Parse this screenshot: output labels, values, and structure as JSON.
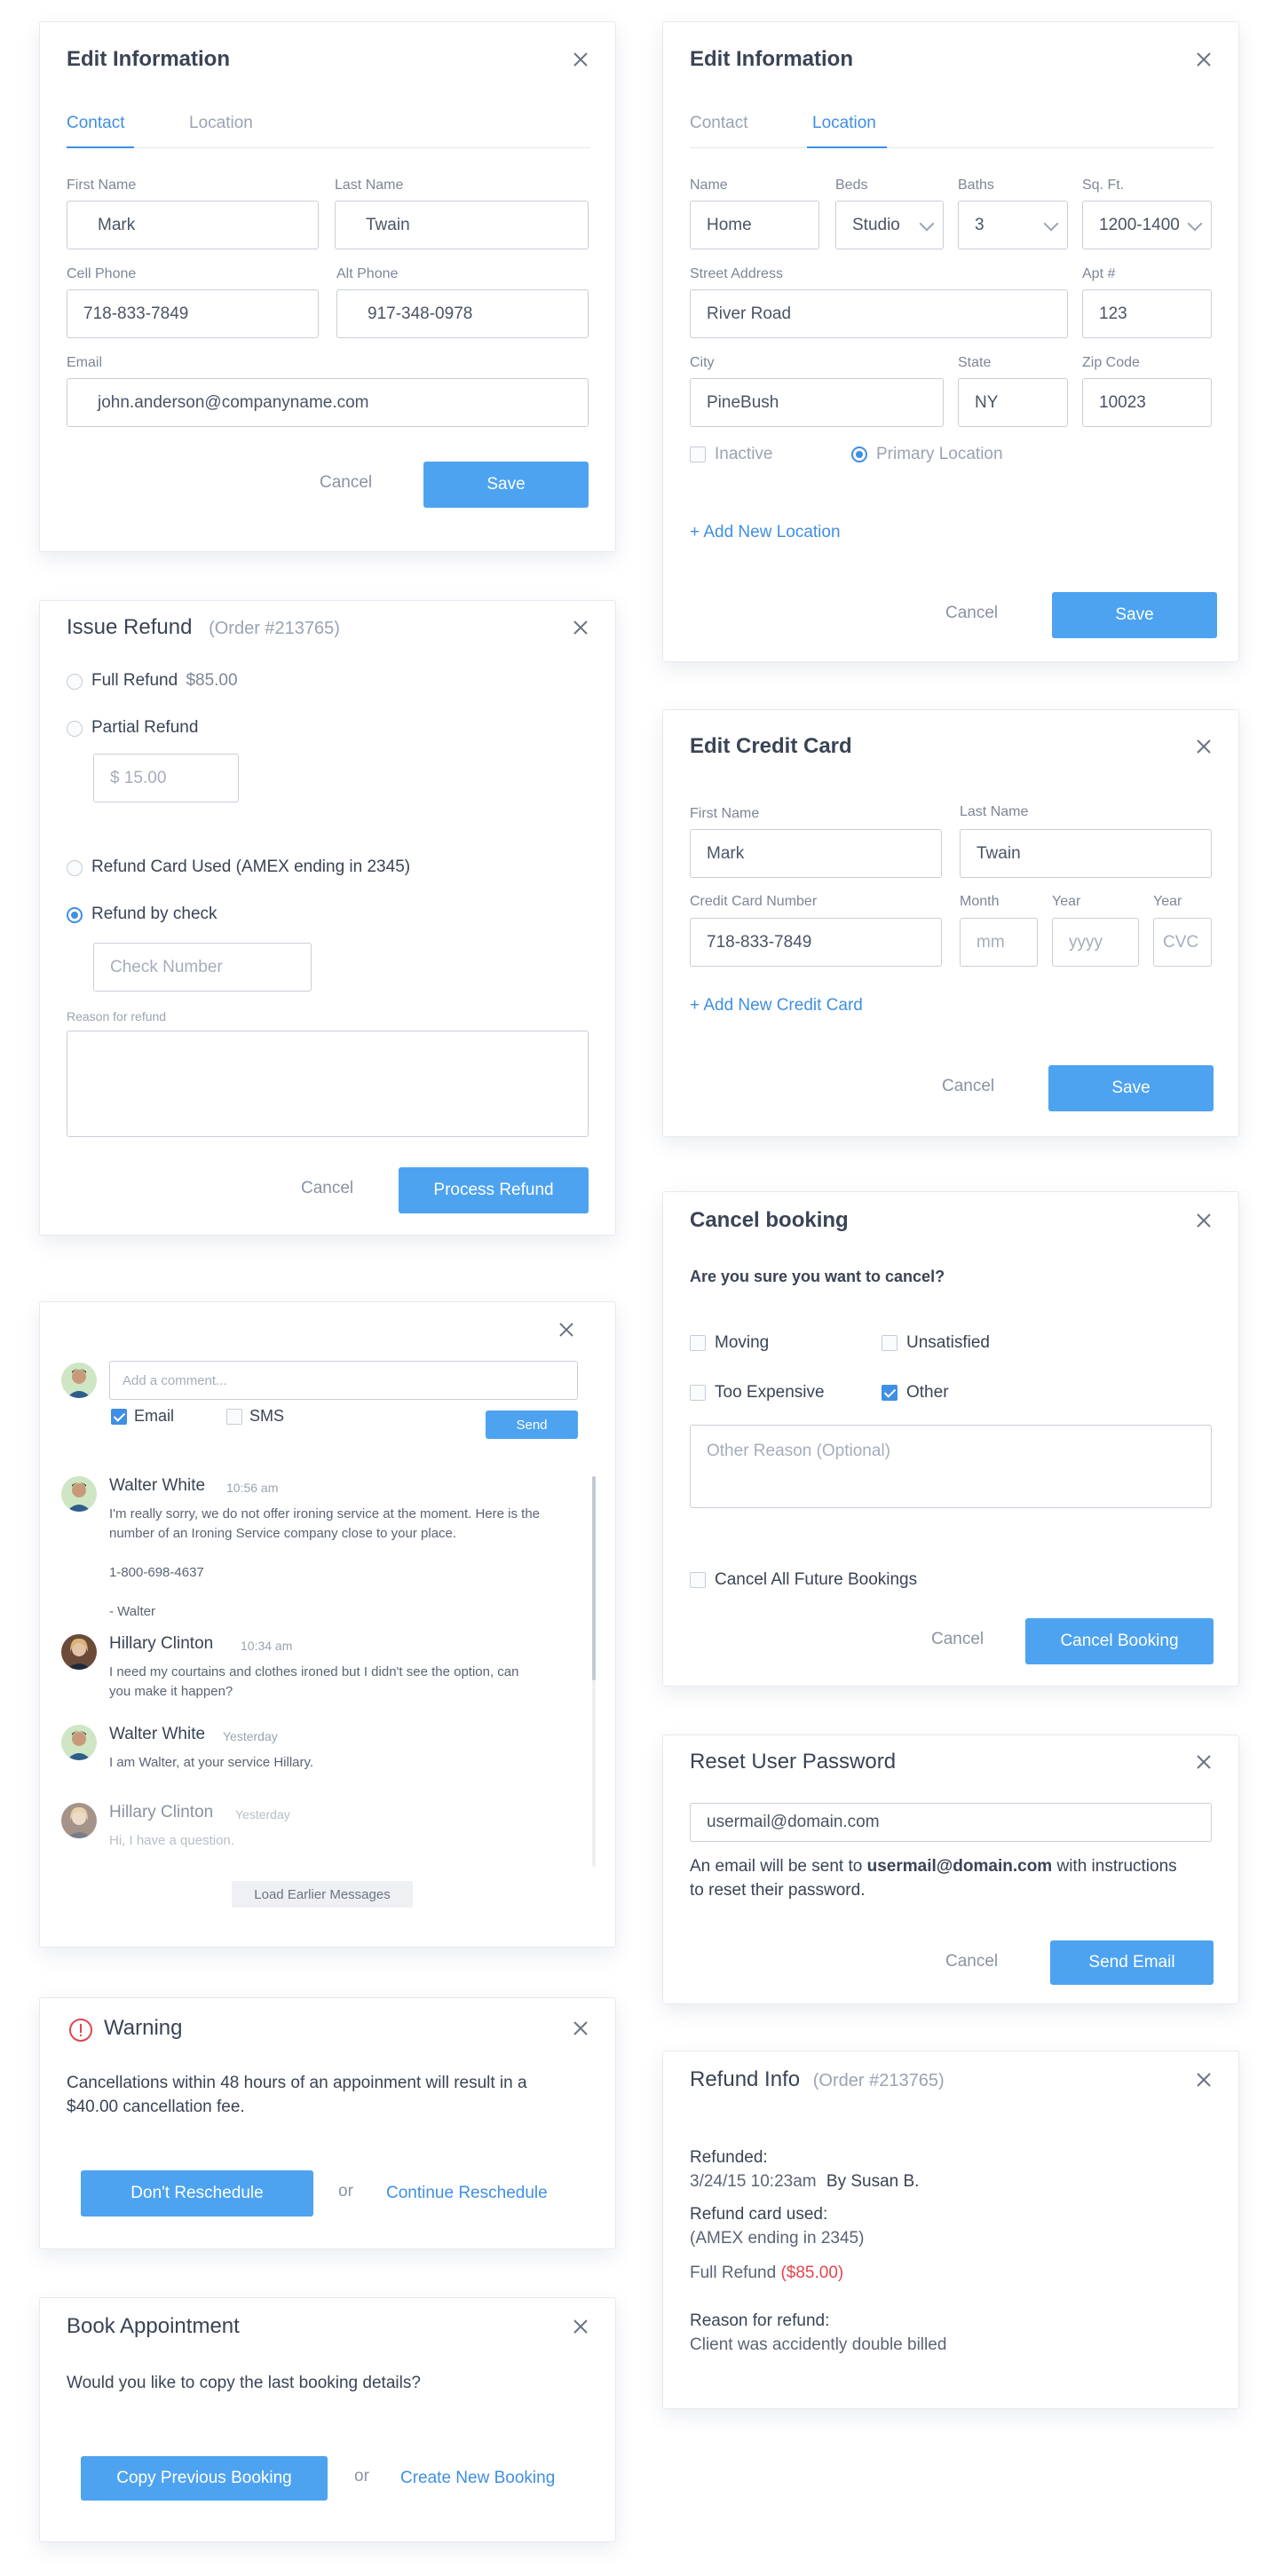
{
  "colors": {
    "accent": "#4da3f0",
    "link": "#3f8fe3",
    "error": "#e0464e",
    "text": "#3a4456",
    "muted": "#9aa3b2"
  },
  "icons": {
    "close": "close-icon",
    "warning": "warning-icon"
  },
  "edit_contact": {
    "title": "Edit Information",
    "tabs": [
      "Contact",
      "Location"
    ],
    "first_name_label": "First Name",
    "first_name": "Mark",
    "last_name_label": "Last Name",
    "last_name": "Twain",
    "cell_label": "Cell Phone",
    "cell": "718-833-7849",
    "alt_label": "Alt Phone",
    "alt": "917-348-0978",
    "email_label": "Email",
    "email": "john.anderson@companyname.com",
    "cancel": "Cancel",
    "save": "Save"
  },
  "edit_location": {
    "title": "Edit Information",
    "tabs": [
      "Contact",
      "Location"
    ],
    "name_label": "Name",
    "name": "Home",
    "beds_label": "Beds",
    "beds": "Studio",
    "baths_label": "Baths",
    "baths": "3",
    "sqft_label": "Sq. Ft.",
    "sqft": "1200-1400",
    "street_label": "Street Address",
    "street": "River Road",
    "apt_label": "Apt #",
    "apt": "123",
    "city_label": "City",
    "city": "PineBush",
    "state_label": "State",
    "state": "NY",
    "zip_label": "Zip Code",
    "zip": "10023",
    "inactive": "Inactive",
    "primary": "Primary Location",
    "add_location": "+ Add New Location",
    "cancel": "Cancel",
    "save": "Save"
  },
  "issue_refund": {
    "title": "Issue Refund",
    "order": "(Order #213765)",
    "full_refund": "Full Refund",
    "full_amount": "$85.00",
    "partial_refund": "Partial Refund",
    "partial_amount": "$ 15.00",
    "card_used": "Refund Card Used (AMEX ending in 2345)",
    "by_check": "Refund by check",
    "check_placeholder": "Check Number",
    "reason_label": "Reason for refund",
    "cancel": "Cancel",
    "process": "Process Refund"
  },
  "edit_card": {
    "title": "Edit Credit Card",
    "first_name_label": "First Name",
    "first_name": "Mark",
    "last_name_label": "Last Name",
    "last_name": "Twain",
    "number_label": "Credit Card Number",
    "number": "718-833-7849",
    "month_label": "Month",
    "month_placeholder": "mm",
    "year_label": "Year",
    "year_placeholder": "yyyy",
    "cvc_label": "Year",
    "cvc_placeholder": "CVC",
    "add_card": "+ Add New Credit Card",
    "cancel": "Cancel",
    "save": "Save"
  },
  "comments": {
    "placeholder": "Add a comment...",
    "email": "Email",
    "sms": "SMS",
    "send": "Send",
    "messages": [
      {
        "name": "Walter White",
        "time": "10:56 am",
        "body": [
          "I'm really sorry, we do not offer ironing service at the moment. Here is the",
          "number of an Ironing Service company close to your place.",
          "",
          "1-800-698-4637",
          "",
          "- Walter"
        ]
      },
      {
        "name": "Hillary Clinton",
        "time": "10:34 am",
        "body": [
          "I need my courtains and clothes ironed but I didn't see the option, can",
          "you make it happen?"
        ]
      },
      {
        "name": "Walter White",
        "time": "Yesterday",
        "body": [
          "I am Walter, at your service Hillary."
        ]
      },
      {
        "name": "Hillary Clinton",
        "time": "Yesterday",
        "body": [
          "Hi, I have a question."
        ]
      }
    ],
    "load_more": "Load Earlier Messages"
  },
  "cancel_booking": {
    "title": "Cancel booking",
    "question": "Are you sure you want to cancel?",
    "reasons": [
      "Moving",
      "Unsatisfied",
      "Too Expensive",
      "Other"
    ],
    "other_placeholder": "Other Reason (Optional)",
    "cancel_all": "Cancel All Future Bookings",
    "cancel": "Cancel",
    "confirm": "Cancel Booking"
  },
  "reset_password": {
    "title": "Reset User Password",
    "email": "usermail@domain.com",
    "info_pre": "An email will be sent to",
    "info_email": "usermail@domain.com",
    "info_post": "with instructions",
    "info_line2": "to reset their password.",
    "cancel": "Cancel",
    "send": "Send Email"
  },
  "warning": {
    "title": "Warning",
    "body_line1": "Cancellations within 48 hours of an appoinment will result in a",
    "body_line2": "$40.00 cancellation fee.",
    "dont": "Don't Reschedule",
    "or": "or",
    "continue": "Continue Reschedule"
  },
  "refund_info": {
    "title": "Refund Info",
    "order": "(Order #213765)",
    "refunded_label": "Refunded:",
    "refunded_date": "3/24/15 10:23am",
    "refunded_by": "By Susan B.",
    "card_label": "Refund card used:",
    "card_value": "(AMEX ending in 2345)",
    "full_refund": "Full Refund",
    "full_amount": "($85.00)",
    "reason_label": "Reason for refund:",
    "reason_value": "Client was accidently double billed"
  },
  "book_appointment": {
    "title": "Book Appointment",
    "question": "Would you like to copy the last booking details?",
    "copy": "Copy Previous Booking",
    "or": "or",
    "create": "Create New Booking"
  }
}
